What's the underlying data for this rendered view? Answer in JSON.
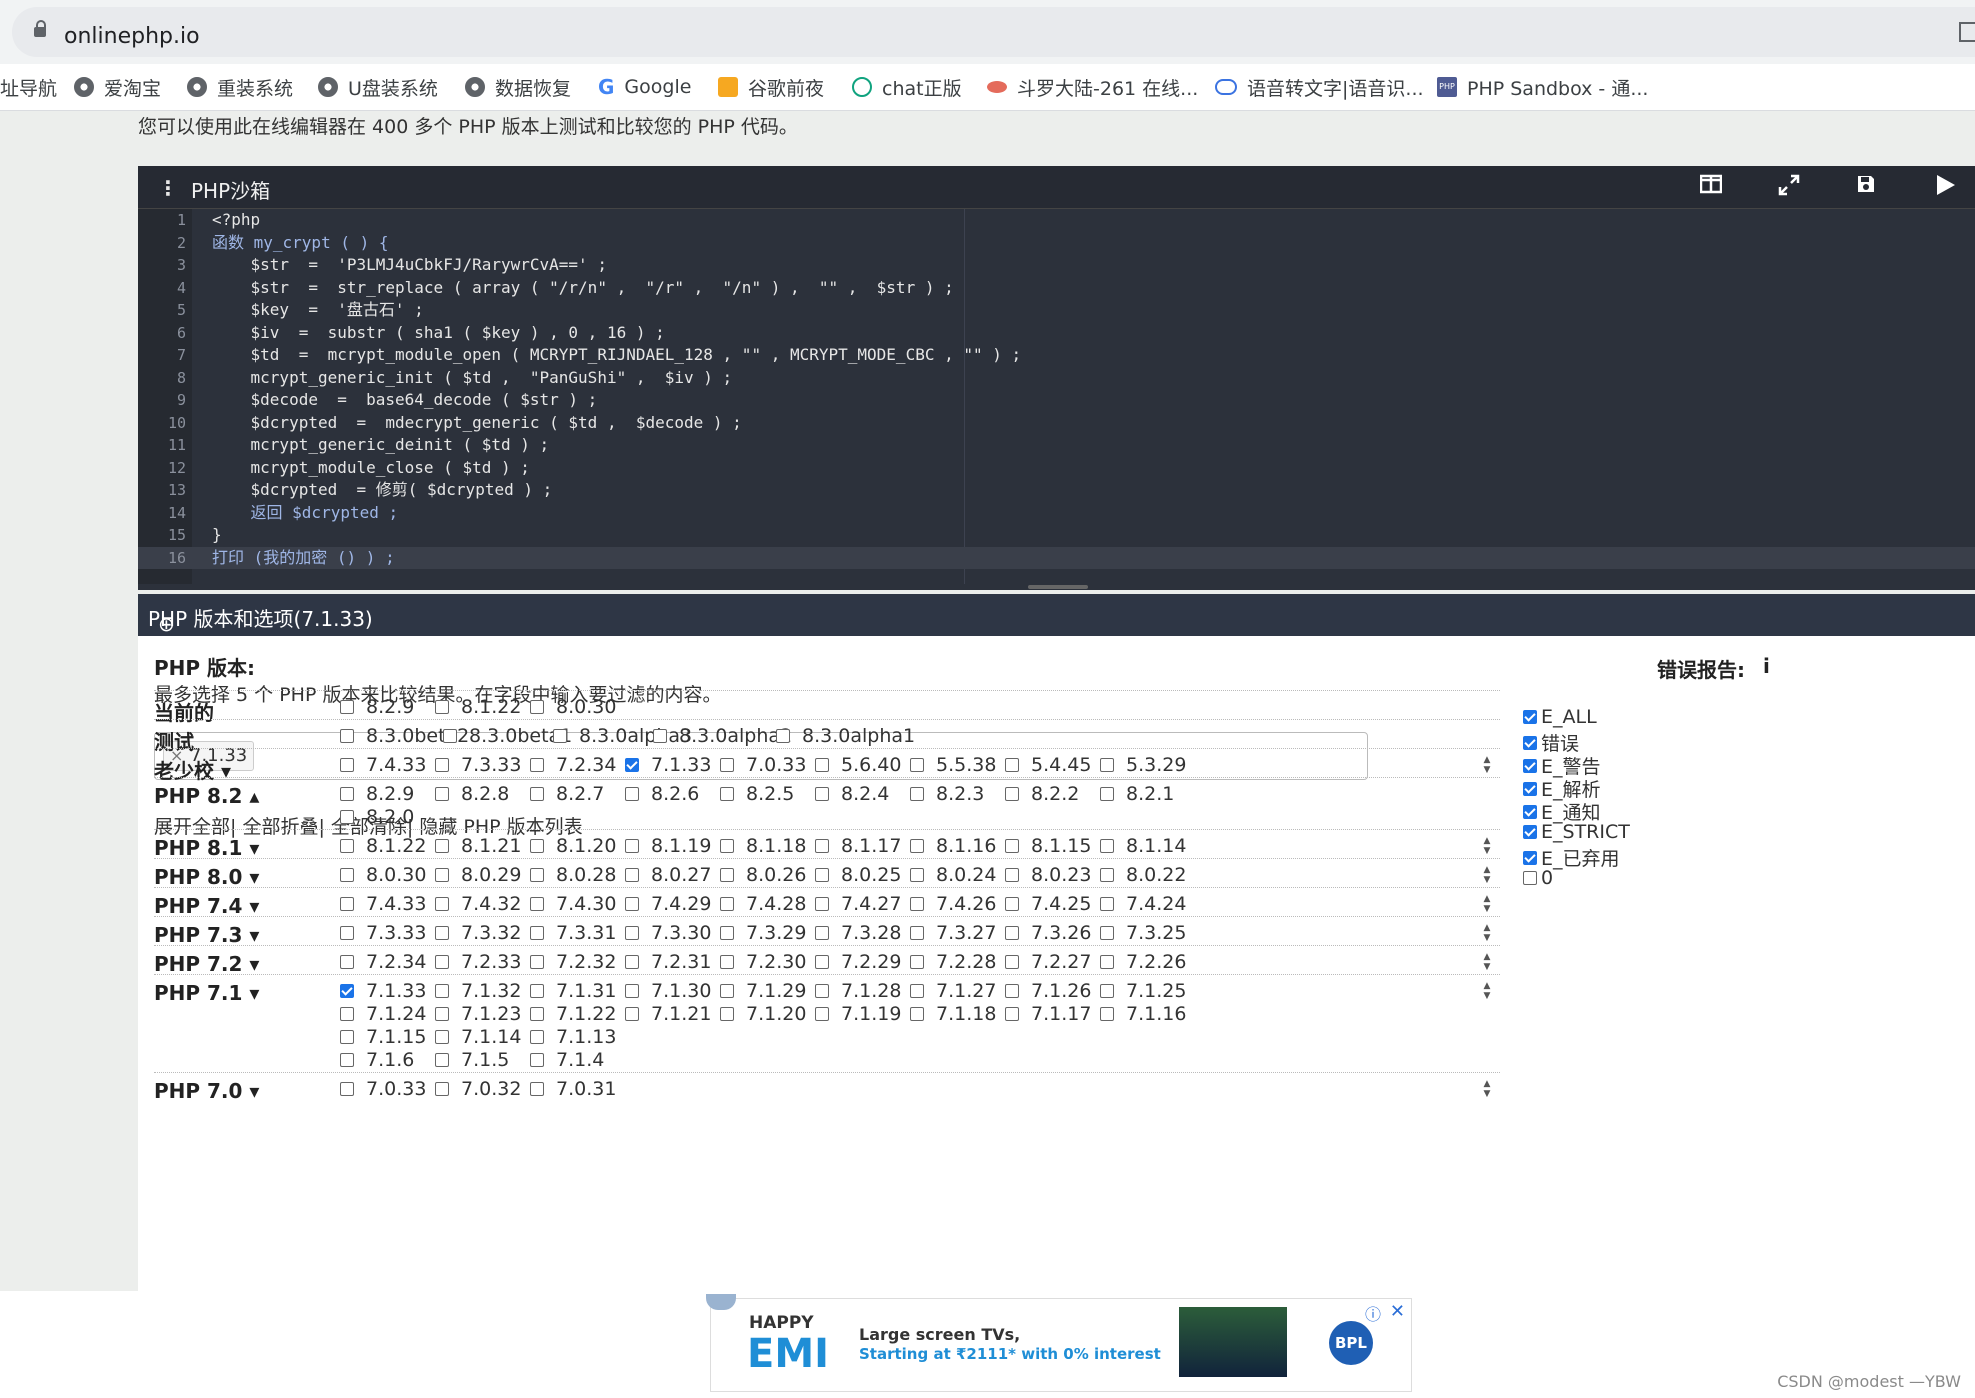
{
  "browser": {
    "url": "onlinephp.io",
    "bookmarks": [
      {
        "label": "址导航",
        "icon": "none"
      },
      {
        "label": "爱淘宝",
        "icon": "globe-icon"
      },
      {
        "label": "重装系统",
        "icon": "globe-icon"
      },
      {
        "label": "U盘装系统",
        "icon": "globe-icon"
      },
      {
        "label": "数据恢复",
        "icon": "globe-icon"
      },
      {
        "label": "Google",
        "icon": "google-icon"
      },
      {
        "label": "谷歌前夜",
        "icon": "2345-icon"
      },
      {
        "label": "chat正版",
        "icon": "chatgpt-icon"
      },
      {
        "label": "斗罗大陆-261 在线...",
        "icon": "douluo-icon"
      },
      {
        "label": "语音转文字|语音识...",
        "icon": "cloud-icon"
      },
      {
        "label": "PHP Sandbox - 通...",
        "icon": "php-icon"
      }
    ]
  },
  "intro": "您可以使用此在线编辑器在 400 多个 PHP 版本上测试和比较您的 PHP 代码。",
  "editor": {
    "title": "PHP沙箱",
    "lines": [
      "<?php",
      "函数 my_crypt ( ) {",
      "    $str  =  'P3LMJ4uCbkFJ/RarywrCvA==' ;",
      "    $str  =  str_replace ( array ( \"/r/n\" ,  \"/r\" ,  \"/n\" ) ,  \"\" ,  $str ) ;",
      "    $key  =  '盘古石' ;",
      "    $iv  =  substr ( sha1 ( $key ) , 0 , 16 ) ;",
      "    $td  =  mcrypt_module_open ( MCRYPT_RIJNDAEL_128 , \"\" , MCRYPT_MODE_CBC , \"\" ) ;",
      "    mcrypt_generic_init ( $td ,  \"PanGuShi\" ,  $iv ) ;",
      "    $decode  =  base64_decode ( $str ) ;",
      "    $dcrypted  =  mdecrypt_generic ( $td ,  $decode ) ;",
      "    mcrypt_generic_deinit ( $td ) ;",
      "    mcrypt_module_close ( $td ) ;",
      "    $dcrypted  = 修剪( $dcrypted ) ;",
      "    返回 $dcrypted ;",
      "}",
      "打印 (我的加密 () ) ;"
    ],
    "line_numbers": [
      "1",
      "2",
      "3",
      "4",
      "5",
      "6",
      "7",
      "8",
      "9",
      "10",
      "11",
      "12",
      "13",
      "14",
      "15",
      "16"
    ]
  },
  "options": {
    "header": "PHP 版本和选项(7.1.33)",
    "php_version_label": "PHP 版本:",
    "hint": "最多选择 5 个 PHP 版本来比较结果。在字段中输入要过滤的内容。",
    "selected_chip": "7.1.33",
    "links": "展开全部| 全部折叠| 全部清除| 隐藏 PHP 版本列表",
    "error_title": "错误报告:",
    "error_info": "i",
    "errors": [
      {
        "label": "E_ALL",
        "checked": true
      },
      {
        "label": "错误",
        "checked": true
      },
      {
        "label": "E_警告",
        "checked": true
      },
      {
        "label": "E_解析",
        "checked": true
      },
      {
        "label": "E_通知",
        "checked": true
      },
      {
        "label": "E_STRICT",
        "checked": true
      },
      {
        "label": "E_已弃用",
        "checked": true
      },
      {
        "label": "0",
        "checked": false
      }
    ],
    "rows": [
      {
        "label": "当前的",
        "versions": [
          [
            "8.2.9",
            "8.1.22",
            "8.0.30"
          ]
        ],
        "checked": []
      },
      {
        "label": "测试",
        "versions": [
          [
            "8.3.0beta2",
            "8.3.0beta1",
            "8.3.0alpha3",
            "8.3.0alpha2",
            "8.3.0alpha1"
          ]
        ],
        "checked": []
      },
      {
        "label": "老少校 ▾",
        "versions": [
          [
            "7.4.33",
            "7.3.33",
            "7.2.34",
            "7.1.33",
            "7.0.33",
            "5.6.40",
            "5.5.38",
            "5.4.45",
            "5.3.29"
          ]
        ],
        "checked": [
          "7.1.33"
        ]
      },
      {
        "label": "PHP 8.2 ▴",
        "versions": [
          [
            "8.2.9",
            "8.2.8",
            "8.2.7",
            "8.2.6",
            "8.2.5",
            "8.2.4",
            "8.2.3",
            "8.2.2",
            "8.2.1"
          ],
          [
            "8.2.0"
          ]
        ],
        "checked": []
      },
      {
        "label": "PHP 8.1 ▾",
        "versions": [
          [
            "8.1.22",
            "8.1.21",
            "8.1.20",
            "8.1.19",
            "8.1.18",
            "8.1.17",
            "8.1.16",
            "8.1.15",
            "8.1.14"
          ]
        ],
        "checked": []
      },
      {
        "label": "PHP 8.0 ▾",
        "versions": [
          [
            "8.0.30",
            "8.0.29",
            "8.0.28",
            "8.0.27",
            "8.0.26",
            "8.0.25",
            "8.0.24",
            "8.0.23",
            "8.0.22"
          ]
        ],
        "checked": []
      },
      {
        "label": "PHP 7.4 ▾",
        "versions": [
          [
            "7.4.33",
            "7.4.32",
            "7.4.30",
            "7.4.29",
            "7.4.28",
            "7.4.27",
            "7.4.26",
            "7.4.25",
            "7.4.24"
          ]
        ],
        "checked": []
      },
      {
        "label": "PHP 7.3 ▾",
        "versions": [
          [
            "7.3.33",
            "7.3.32",
            "7.3.31",
            "7.3.30",
            "7.3.29",
            "7.3.28",
            "7.3.27",
            "7.3.26",
            "7.3.25"
          ]
        ],
        "checked": []
      },
      {
        "label": "PHP 7.2 ▾",
        "versions": [
          [
            "7.2.34",
            "7.2.33",
            "7.2.32",
            "7.2.31",
            "7.2.30",
            "7.2.29",
            "7.2.28",
            "7.2.27",
            "7.2.26"
          ]
        ],
        "checked": []
      },
      {
        "label": "PHP 7.1 ▾",
        "versions": [
          [
            "7.1.33",
            "7.1.32",
            "7.1.31",
            "7.1.30",
            "7.1.29",
            "7.1.28",
            "7.1.27",
            "7.1.26",
            "7.1.25"
          ],
          [
            "7.1.24",
            "7.1.23",
            "7.1.22",
            "7.1.21",
            "7.1.20",
            "7.1.19",
            "7.1.18",
            "7.1.17",
            "7.1.16"
          ],
          [
            "7.1.15",
            "7.1.14",
            "7.1.13"
          ],
          [
            "7.1.6",
            "7.1.5",
            "7.1.4"
          ]
        ],
        "checked": [
          "7.1.33"
        ]
      },
      {
        "label": "PHP 7.0 ▾",
        "versions": [
          [
            "7.0.33",
            "7.0.32",
            "7.0.31"
          ]
        ],
        "checked": []
      }
    ]
  },
  "ad": {
    "brand_top": "HAPPY",
    "brand": "EMI",
    "line1": "Large screen TVs,",
    "line2": "Starting at ₹2111* with 0% interest",
    "logo": "BPL",
    "close": "✕",
    "info": "ⓘ"
  },
  "watermark": "CSDN @modest —YBW",
  "colors": {
    "accent": "#1a73e8",
    "editor_bg": "#2c313b",
    "header_bg": "#2e3645"
  }
}
